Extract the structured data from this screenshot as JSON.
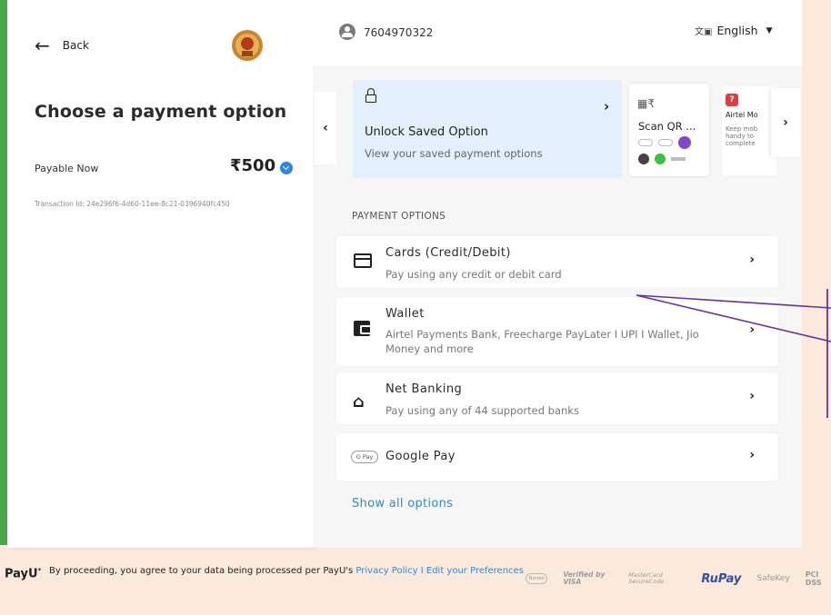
{
  "left": {
    "back_label": "Back",
    "title": "Choose a payment option",
    "payable_label": "Payable Now",
    "amount": "₹500",
    "transaction": "Transaction Id: 24e296f6-4d60-11ee-8c21-0396940fc450"
  },
  "header": {
    "phone": "7604970322",
    "language": "English",
    "language_icon": "translate-icon"
  },
  "saved": {
    "unlock_title": "Unlock Saved Option",
    "unlock_subtitle": "View your saved payment options",
    "qr_title": "Scan QR ...",
    "airtel_title": "Airtel Mo",
    "airtel_desc": "Keep mob handy to complete"
  },
  "payment_options": {
    "section_label": "PAYMENT OPTIONS",
    "items": [
      {
        "title": "Cards (Credit/Debit)",
        "subtitle": "Pay using any credit or debit card",
        "icon": "credit-card-icon"
      },
      {
        "title": "Wallet",
        "subtitle": "Airtel Payments Bank, Freecharge PayLater I UPI I Wallet, Jio Money and more",
        "icon": "wallet-icon"
      },
      {
        "title": "Net Banking",
        "subtitle": "Pay using any of 44 supported banks",
        "icon": "bank-icon"
      },
      {
        "title": "Google Pay",
        "subtitle": "",
        "icon": "google-pay-icon"
      }
    ],
    "show_all": "Show all options"
  },
  "footer": {
    "brand": "PayU",
    "text": "By proceeding, you agree to your data being processed per PayU's",
    "privacy_link": "Privacy Policy",
    "separator": "I",
    "preferences_link": "Edit your Preferences",
    "badges": [
      "Norton",
      "Verified by VISA",
      "MasterCard SecureCode",
      "RuPay",
      "SafeKey",
      "PCI DSS"
    ]
  },
  "colors": {
    "accent": "#2e8ad8",
    "left_strip": "#4aa84b",
    "background": "#fbe9dc",
    "callout": "#6b2fa0"
  }
}
